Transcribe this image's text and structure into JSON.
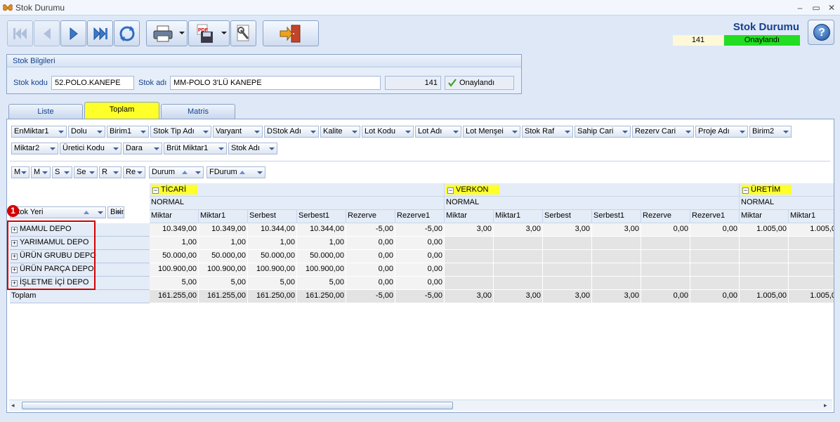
{
  "window": {
    "title": "Stok Durumu",
    "colors": {
      "accent": "#15428b",
      "approved": "#22dd22",
      "highlight": "#ffff2a",
      "marker": "#d40000"
    }
  },
  "header": {
    "title": "Stok Durumu",
    "number": "141",
    "status": "Onaylandı"
  },
  "toolbar": {
    "icons": [
      "first-icon",
      "prev-icon",
      "next-icon",
      "last-icon",
      "refresh-icon",
      "print-icon",
      "pdf-save-icon",
      "tools-icon",
      "exit-icon"
    ]
  },
  "stock_info": {
    "caption": "Stok Bilgileri",
    "code_label": "Stok kodu",
    "code_value": "52.POLO.KANEPE",
    "name_label": "Stok adı",
    "name_value": "MM-POLO 3'LÜ KANEPE",
    "number": "141",
    "approved_label": "Onaylandı"
  },
  "tabs": [
    "Liste",
    "Toplam",
    "Matris"
  ],
  "filter_fields_row1": [
    "EnMiktar1",
    "Dolu",
    "Birim1",
    "Stok Tip Adı",
    "Varyant",
    "DStok Adı",
    "Kalite",
    "Lot Kodu",
    "Lot Adı",
    "Lot Menşei",
    "Stok Raf",
    "Sahip Cari",
    "Rezerv Cari",
    "Proje Adı",
    "Birim2"
  ],
  "filter_fields_row2": [
    "Miktar2",
    "Üretici Kodu",
    "Dara",
    "Brüt Miktar1",
    "Stok Adı"
  ],
  "column_fields": [
    "M",
    "M",
    "S",
    "Se",
    "R",
    "Re"
  ],
  "column_fields_sorted": [
    "Durum",
    "FDurum"
  ],
  "row_fields": [
    "Stok Yeri",
    "Birim"
  ],
  "callout": "1",
  "groups": [
    {
      "name": "TİCARİ",
      "sub": "NORMAL"
    },
    {
      "name": "VERKON",
      "sub": "NORMAL"
    },
    {
      "name": "ÜRETİM",
      "sub": "NORMAL"
    }
  ],
  "measures": [
    "Miktar",
    "Miktar1",
    "Serbest",
    "Serbest1",
    "Rezerve",
    "Rezerve1"
  ],
  "measures_partial": [
    "Miktar",
    "Miktar1"
  ],
  "rows": [
    {
      "label": "MAMUL DEPO",
      "vals": [
        "10.349,00",
        "10.349,00",
        "10.344,00",
        "10.344,00",
        "-5,00",
        "-5,00",
        "3,00",
        "3,00",
        "3,00",
        "3,00",
        "0,00",
        "0,00",
        "1.005,00",
        "1.005,0"
      ]
    },
    {
      "label": "YARIMAMUL DEPO",
      "vals": [
        "1,00",
        "1,00",
        "1,00",
        "1,00",
        "0,00",
        "0,00",
        "",
        "",
        "",
        "",
        "",
        "",
        "",
        ""
      ]
    },
    {
      "label": "ÜRÜN GRUBU DEPO",
      "vals": [
        "50.000,00",
        "50.000,00",
        "50.000,00",
        "50.000,00",
        "0,00",
        "0,00",
        "",
        "",
        "",
        "",
        "",
        "",
        "",
        ""
      ]
    },
    {
      "label": "ÜRÜN PARÇA DEPO",
      "vals": [
        "100.900,00",
        "100.900,00",
        "100.900,00",
        "100.900,00",
        "0,00",
        "0,00",
        "",
        "",
        "",
        "",
        "",
        "",
        "",
        ""
      ]
    },
    {
      "label": "İŞLETME İÇİ DEPO",
      "vals": [
        "5,00",
        "5,00",
        "5,00",
        "5,00",
        "0,00",
        "0,00",
        "",
        "",
        "",
        "",
        "",
        "",
        "",
        ""
      ]
    }
  ],
  "total": {
    "label": "Toplam",
    "vals": [
      "161.255,00",
      "161.255,00",
      "161.250,00",
      "161.250,00",
      "-5,00",
      "-5,00",
      "3,00",
      "3,00",
      "3,00",
      "3,00",
      "0,00",
      "0,00",
      "1.005,00",
      "1.005,0"
    ]
  }
}
